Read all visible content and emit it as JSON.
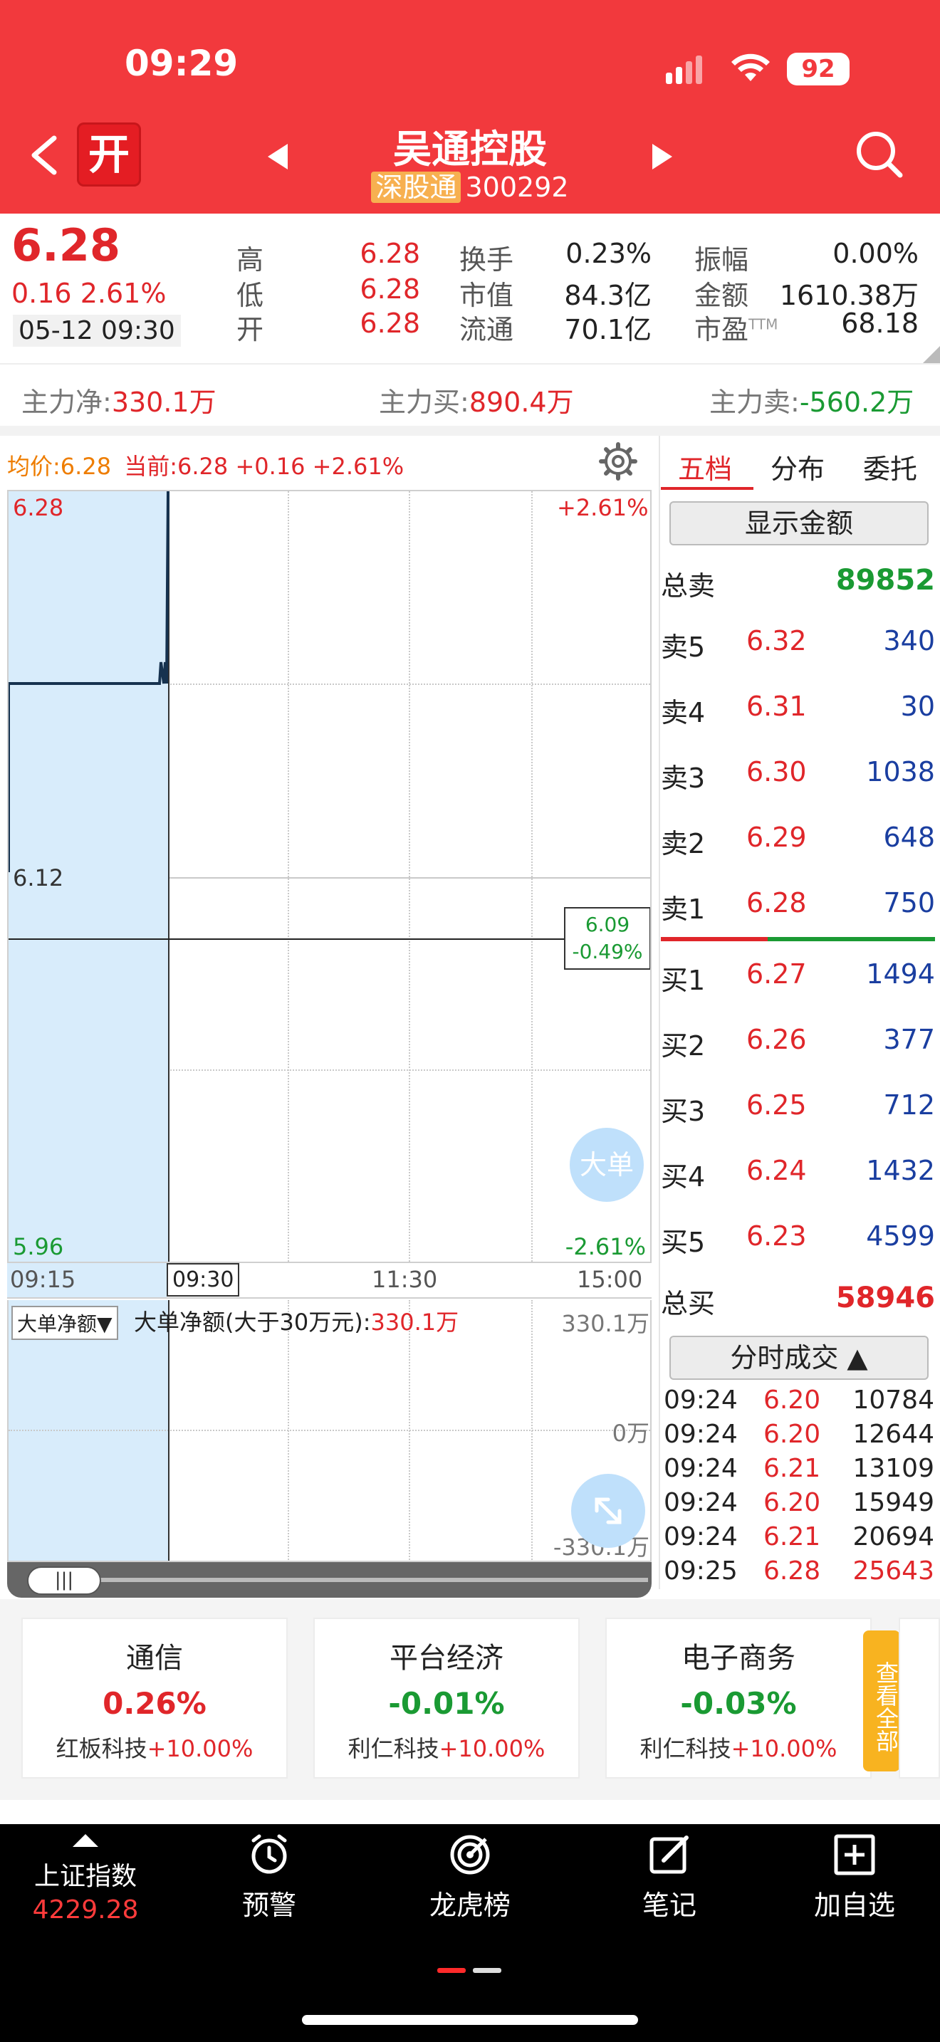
{
  "status_bar": {
    "time": "09:29",
    "battery": "92"
  },
  "header": {
    "title": "吴通控股",
    "board": "深股通",
    "code": "300292",
    "logo_char": "开"
  },
  "quote": {
    "price": "6.28",
    "change": "0.16",
    "change_pct": "2.61%",
    "datetime": "05-12 09:30",
    "stats": [
      {
        "label": "高",
        "value": "6.28"
      },
      {
        "label": "低",
        "value": "6.28"
      },
      {
        "label": "开",
        "value": "6.28"
      },
      {
        "label": "换手",
        "value": "0.23%"
      },
      {
        "label": "市值",
        "value": "84.3亿"
      },
      {
        "label": "流通",
        "value": "70.1亿"
      },
      {
        "label": "振幅",
        "value": "0.00%"
      },
      {
        "label": "金额",
        "value": "1610.38万"
      },
      {
        "label": "市盈",
        "sup": "TTM",
        "value": "68.18"
      }
    ]
  },
  "capital": {
    "net_label": "主力净:",
    "net": "330.1万",
    "buy_label": "主力买:",
    "buy": "890.4万",
    "sell_label": "主力卖:",
    "sell": "-560.2万"
  },
  "chart": {
    "avg_label": "均价:",
    "avg": "6.28",
    "cur_label": "当前:",
    "cur": "6.28 +0.16 +2.61%",
    "y_top": "6.28",
    "y_mid": "6.12",
    "y_bot": "5.96",
    "pct_top": "+2.61%",
    "pct_bot": "-2.61%",
    "cursor_price": "6.09",
    "cursor_pct": "-0.49%",
    "x_labels": [
      "09:15",
      "09:30",
      "11:30",
      "15:00"
    ],
    "big_order_btn": "大单"
  },
  "lower_chart": {
    "selector": "大单净额▼",
    "label": "大单净额(大于30万元):",
    "value": "330.1万",
    "y_top": "330.1万",
    "y_mid": "0万",
    "y_bot": "-330.1万"
  },
  "orderbook": {
    "tabs": [
      "五档",
      "分布",
      "委托"
    ],
    "show_amount": "显示金额",
    "total_sell_label": "总卖",
    "total_sell": "89852",
    "sells": [
      {
        "label": "卖5",
        "price": "6.32",
        "vol": "340"
      },
      {
        "label": "卖4",
        "price": "6.31",
        "vol": "30"
      },
      {
        "label": "卖3",
        "price": "6.30",
        "vol": "1038"
      },
      {
        "label": "卖2",
        "price": "6.29",
        "vol": "648"
      },
      {
        "label": "卖1",
        "price": "6.28",
        "vol": "750"
      }
    ],
    "buys": [
      {
        "label": "买1",
        "price": "6.27",
        "vol": "1494"
      },
      {
        "label": "买2",
        "price": "6.26",
        "vol": "377"
      },
      {
        "label": "买3",
        "price": "6.25",
        "vol": "712"
      },
      {
        "label": "买4",
        "price": "6.24",
        "vol": "1432"
      },
      {
        "label": "买5",
        "price": "6.23",
        "vol": "4599"
      }
    ],
    "total_buy_label": "总买",
    "total_buy": "58946",
    "ticks_btn": "分时成交 ▲",
    "ticks": [
      {
        "t": "09:24",
        "p": "6.20",
        "v": "10784"
      },
      {
        "t": "09:24",
        "p": "6.20",
        "v": "12644"
      },
      {
        "t": "09:24",
        "p": "6.21",
        "v": "13109"
      },
      {
        "t": "09:24",
        "p": "6.20",
        "v": "15949"
      },
      {
        "t": "09:24",
        "p": "6.21",
        "v": "20694"
      },
      {
        "t": "09:25",
        "p": "6.28",
        "v": "25643"
      }
    ]
  },
  "sectors": [
    {
      "name": "通信",
      "pct": "0.26%",
      "leader": "红板科技",
      "leader_pct": "+10.00%"
    },
    {
      "name": "平台经济",
      "pct": "-0.01%",
      "leader": "利仁科技",
      "leader_pct": "+10.00%"
    },
    {
      "name": "电子商务",
      "pct": "-0.03%",
      "leader": "利仁科技",
      "leader_pct": "+10.00%"
    }
  ],
  "see_all": "查看全部",
  "bottom_nav": {
    "index_name": "上证指数",
    "index_value": "4229.28",
    "items": [
      "预警",
      "龙虎榜",
      "笔记",
      "加自选"
    ]
  },
  "colors": {
    "brand_red": "#f2393d",
    "up": "#e0262a",
    "down": "#1a9a33",
    "vol_blue": "#1a3ea0",
    "chart_bg": "#d8ecfb"
  }
}
